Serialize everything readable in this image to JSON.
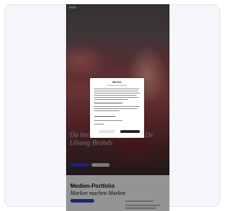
{
  "hero": {
    "heading": "Da bin ich Drei Quote BILDe Lösung Brands"
  },
  "section": {
    "title": "Medien-Portfolio",
    "subtitle": "Marken machen Marken"
  },
  "consent": {
    "logo": "BILDs",
    "title": "Wir brauchen Ihre Zustimmung"
  },
  "colors": {
    "accent": "#2f3fcf",
    "modal_button_dark": "#222222"
  }
}
